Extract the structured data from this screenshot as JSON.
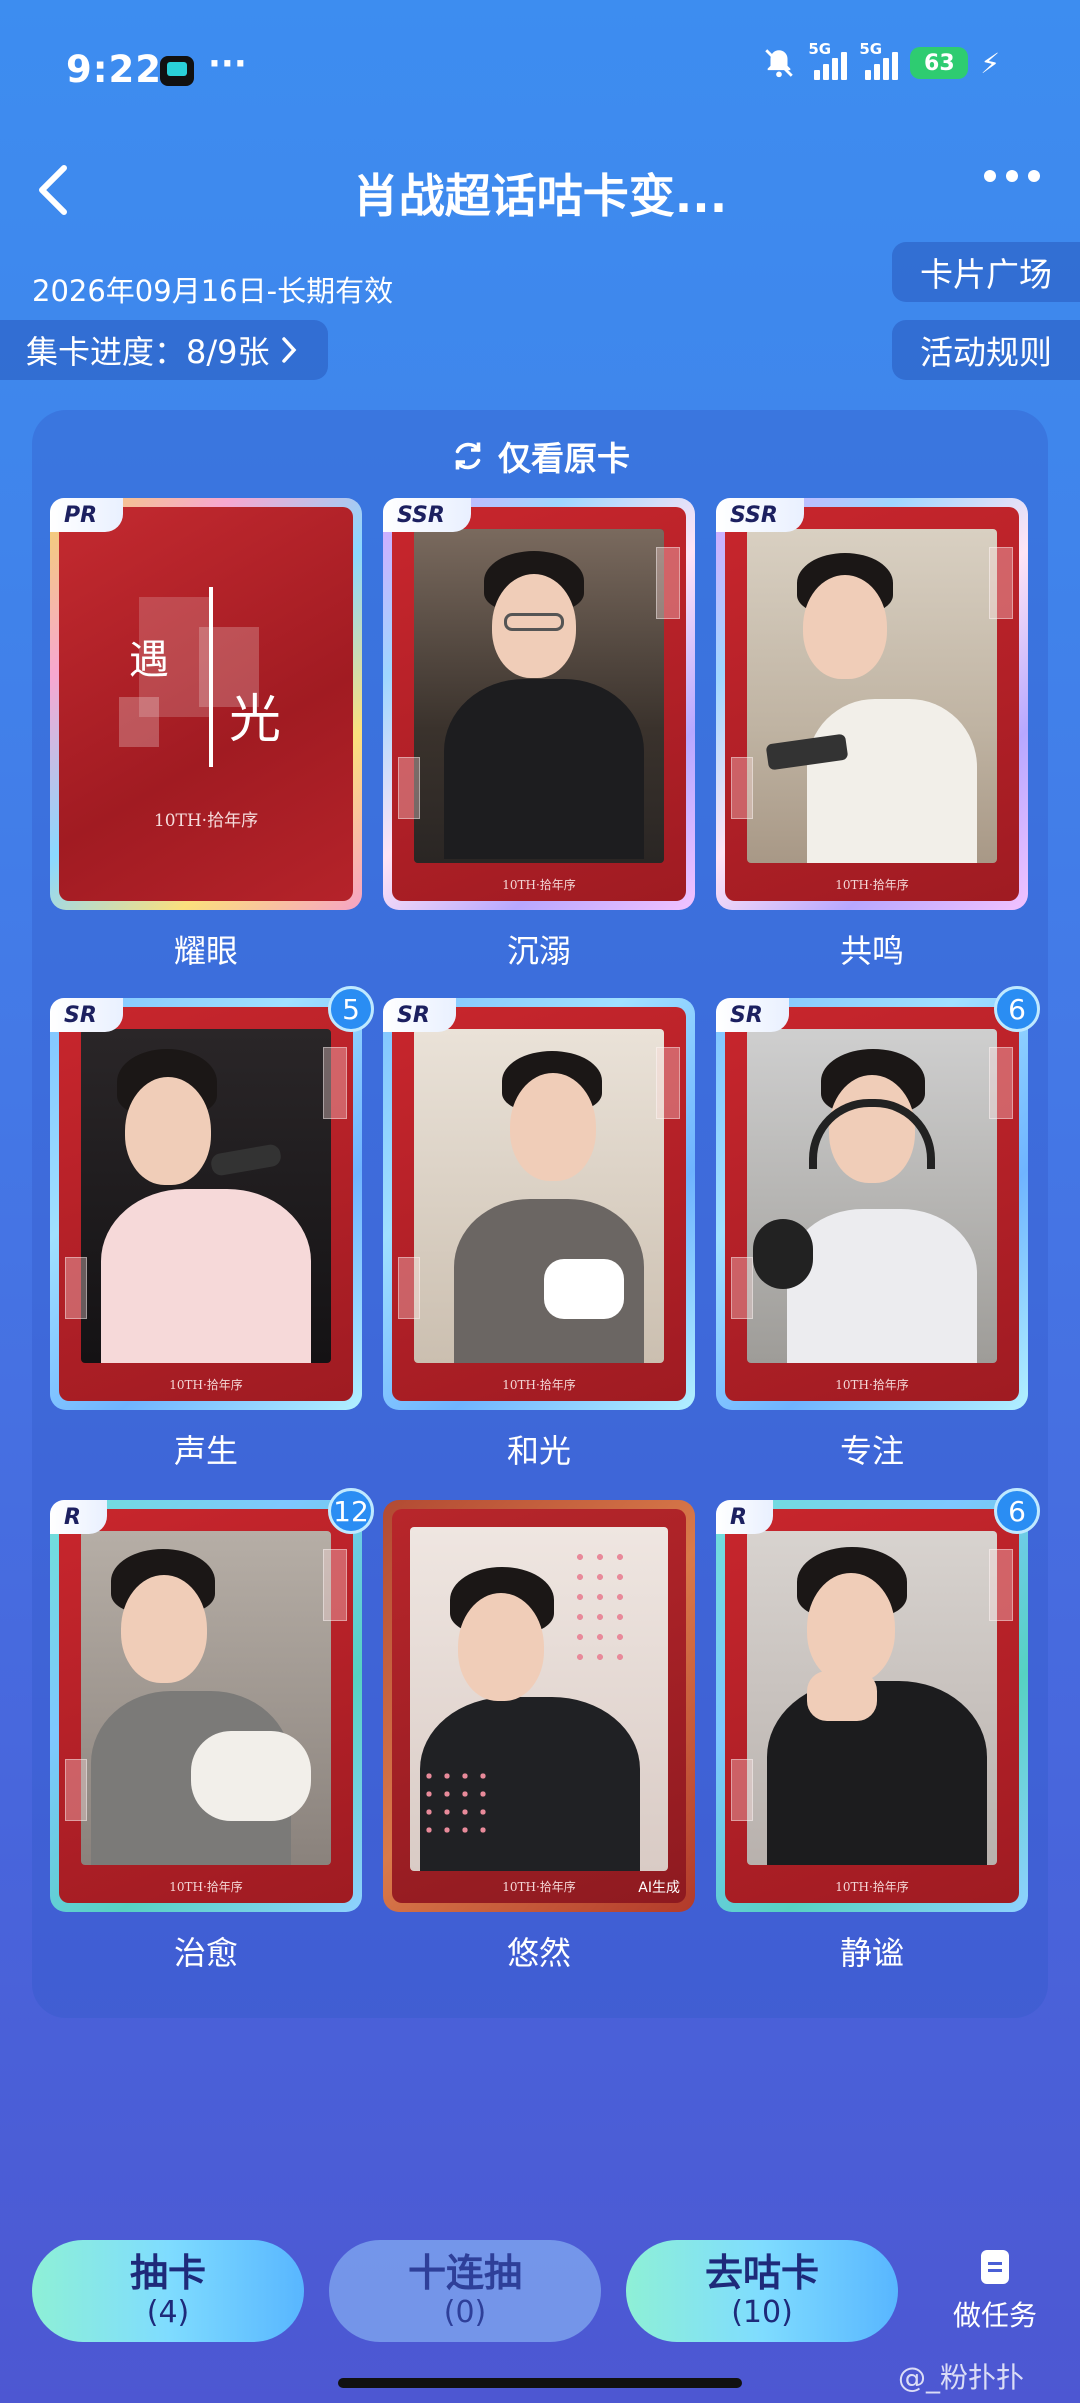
{
  "status_bar": {
    "time": "9:22",
    "more": "···",
    "network1": "5G",
    "network2": "5G",
    "battery": "63"
  },
  "header": {
    "title": "肖战超话咕卡变...",
    "menu_icon": "more-dots-icon"
  },
  "event": {
    "validity": "2026年09月16日-长期有效",
    "progress": "集卡进度：8/9张",
    "card_square": "卡片广场",
    "rules": "活动规则"
  },
  "filter": {
    "label": "仅看原卡"
  },
  "cards": [
    {
      "name": "耀眼",
      "rarity": "PR",
      "count": "",
      "caption": "10TH·拾年序",
      "title_glyph1": "遇",
      "title_glyph2": "光"
    },
    {
      "name": "沉溺",
      "rarity": "SSR",
      "count": "",
      "caption": "10TH·拾年序"
    },
    {
      "name": "共鸣",
      "rarity": "SSR",
      "count": "",
      "caption": "10TH·拾年序"
    },
    {
      "name": "声生",
      "rarity": "SR",
      "count": "5",
      "caption": "10TH·拾年序"
    },
    {
      "name": "和光",
      "rarity": "SR",
      "count": "",
      "caption": "10TH·拾年序"
    },
    {
      "name": "专注",
      "rarity": "SR",
      "count": "6",
      "caption": "10TH·拾年序"
    },
    {
      "name": "治愈",
      "rarity": "R",
      "count": "12",
      "caption": "10TH·拾年序"
    },
    {
      "name": "悠然",
      "rarity": "",
      "count": "",
      "caption": "10TH·拾年序",
      "ai_label": "AI生成"
    },
    {
      "name": "静谧",
      "rarity": "R",
      "count": "6",
      "caption": "10TH·拾年序"
    }
  ],
  "actions": {
    "draw": {
      "label": "抽卡",
      "count": "(4)"
    },
    "draw10": {
      "label": "十连抽",
      "count": "(0)"
    },
    "trade": {
      "label": "去咕卡",
      "count": "(10)"
    },
    "task": {
      "label": "做任务"
    }
  },
  "watermark": "@_粉扑扑"
}
